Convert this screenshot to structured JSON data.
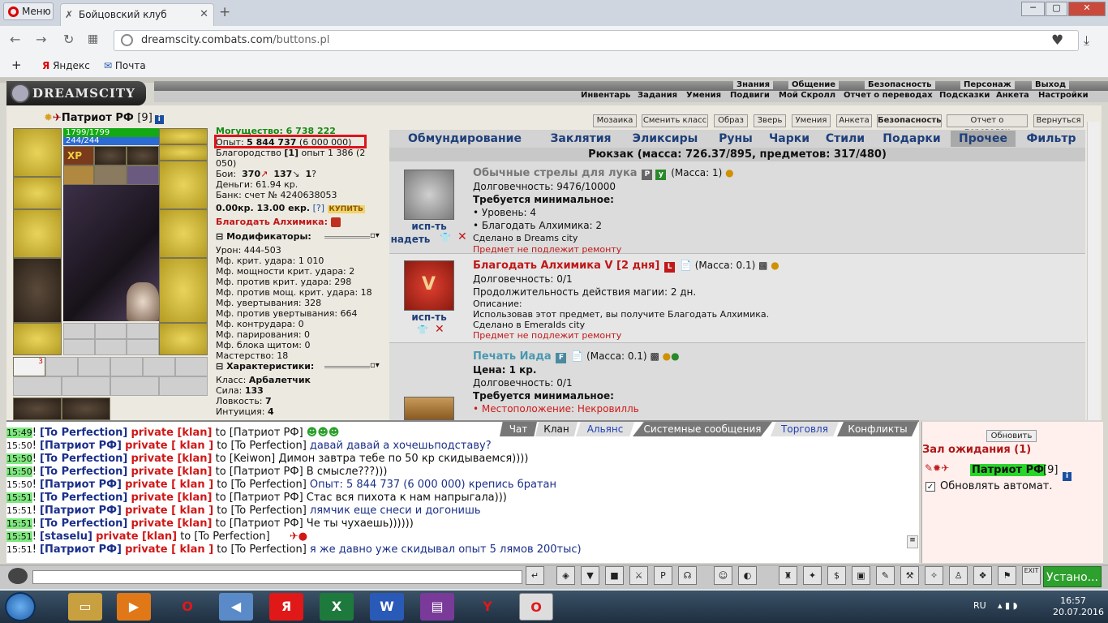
{
  "browser": {
    "menu_label": "Меню",
    "tab_title": "Бойцовский клуб",
    "url_host": "dreamscity.combats.com",
    "url_path": "/buttons.pl",
    "bookmarks": [
      "Яндекс",
      "Почта"
    ]
  },
  "game": {
    "logo": "DREAMSCITY",
    "top_menu": [
      "Знания",
      "Общение",
      "Безопасность",
      "Персонаж",
      "Выход"
    ],
    "sub_menu": [
      "Инвентарь",
      "Задания",
      "Умения",
      "Подвиги",
      "Мой Скролл",
      "Отчет о переводах",
      "Подсказки",
      "Анкета",
      "Настройки"
    ],
    "char": {
      "name": "Патриот РФ",
      "level": "[9]",
      "info_icon": "i",
      "hp": "1799/1799",
      "mp": "244/244",
      "belt_count": "3"
    },
    "stats": {
      "power": "Могущество: 6 738 222",
      "exp_label": "Опыт:",
      "exp_value": "5 844 737",
      "exp_next": "(6 000 000)",
      "nobility": "Благородство",
      "nobility_lvl": "[1]",
      "nobility_exp": "опыт 1 386 (2 050)",
      "fights": "Бои:",
      "wins": "370",
      "losses": "137",
      "draws": "1",
      "money": "Деньги: 61.94 кр.",
      "bank": "Банк: счет № 4240638053",
      "bank_kr": "0.00кр. 13.00 екр.",
      "help": "[?]",
      "buy": "КУПИТЬ",
      "blessing": "Благодать Алхимика:",
      "mods_header": "Модификаторы:",
      "mods": [
        "Урон: 444-503",
        "Мф. крит. удара: 1 010",
        "Мф. мощности крит. удара: 2",
        "Мф. против крит. удара: 298",
        "Мф. против мощ. крит. удара: 18",
        "Мф. увертывания: 328",
        "Мф. против увертывания: 664",
        "Мф. контрудара: 0",
        "Мф. парирования: 0",
        "Мф. блока щитом: 0",
        "Мастерство: 18"
      ],
      "chars_header": "Характеристики:",
      "chars": [
        "Класс:",
        "Арбалетчик",
        "Сила:",
        "133",
        "Ловкость:",
        "7",
        "Интуиция:",
        "4"
      ]
    },
    "buttons": [
      "Мозаика",
      "Сменить класс",
      "Образ",
      "Зверь",
      "Умения",
      "Анкета",
      "Безопасность",
      "Отчет о переводах",
      "Вернуться"
    ],
    "inv_tabs": [
      "Обмундирование",
      "Заклятия",
      "Эликсиры",
      "Руны",
      "Чарки",
      "Стили",
      "Подарки",
      "Прочее",
      "Фильтр"
    ],
    "rucksack": "Рюкзак (масса: 726.37/895, предметов: 317/480)",
    "items": [
      {
        "name": "Обычные стрелы для лука",
        "badges": [
          "P",
          "у"
        ],
        "mass": "(Масса: 1)",
        "durability": "Долговечность: 9476/10000",
        "req": "Требуется минимальное:",
        "req_items": [
          "• Уровень: 4",
          "• Благодать Алхимика: 2"
        ],
        "made": "Сделано в Dreams city",
        "norepair": "Предмет не подлежит ремонту",
        "act1": "исп-ть",
        "act2": "надеть"
      },
      {
        "name": "Благодать Алхимика V [2 дня]",
        "badge": "L",
        "mass": "(Масса: 0.1)",
        "durability": "Долговечность: 0/1",
        "duration": "Продолжительность действия магии: 2 дн.",
        "desc_label": "Описание:",
        "desc": "Использовав этот предмет, вы получите Благодать Алхимика.",
        "made": "Сделано в Emeralds city",
        "norepair": "Предмет не подлежит ремонту",
        "act1": "исп-ть"
      },
      {
        "name": "Печать Иада",
        "badge": "F",
        "mass": "(Масса: 0.1)",
        "price": "Цена: 1 кр.",
        "durability": "Долговечность: 0/1",
        "req": "Требуется минимальное:",
        "location": "• Местоположение: Некровилль"
      }
    ]
  },
  "chat": {
    "tabs": [
      "Чат",
      "Клан",
      "Альянс",
      "Системные сообщения",
      "Торговля",
      "Конфликты"
    ],
    "lines": [
      {
        "time": "15:49",
        "hl": true,
        "nick": "[To Perfection]",
        "priv": "private [klan]",
        "to": "to [Патриот РФ]",
        "text": ""
      },
      {
        "time": "15:50",
        "hl": false,
        "nick": "[Патриот РФ]",
        "priv": "private [ klan ]",
        "to": "to [To Perfection]",
        "text": "давай давай а хочешьподставу?"
      },
      {
        "time": "15:50",
        "hl": true,
        "nick": "[To Perfection]",
        "priv": "private [klan]",
        "to": "to [Keiwon]",
        "text": "Димон завтра тебе по 50 кр скидываемся))))"
      },
      {
        "time": "15:50",
        "hl": true,
        "nick": "[To Perfection]",
        "priv": "private [klan]",
        "to": "to [Патриот РФ]",
        "text": "В смысле???)))"
      },
      {
        "time": "15:50",
        "hl": false,
        "nick": "[Патриот РФ]",
        "priv": "private [ klan ]",
        "to": "to [To Perfection]",
        "text": "Опыт: 5 844 737 (6 000 000) крепись братан"
      },
      {
        "time": "15:51",
        "hl": true,
        "nick": "[To Perfection]",
        "priv": "private [klan]",
        "to": "to [Патриот РФ]",
        "text": "Стас вся пихота к нам напрыгала)))"
      },
      {
        "time": "15:51",
        "hl": false,
        "nick": "[Патриот РФ]",
        "priv": "private [ klan ]",
        "to": "to [To Perfection]",
        "text": "лямчик еще снеси и догонишь"
      },
      {
        "time": "15:51",
        "hl": true,
        "nick": "[To Perfection]",
        "priv": "private [klan]",
        "to": "to [Патриот РФ]",
        "text": "Че ты чухаешь))))))"
      },
      {
        "time": "15:51",
        "hl": true,
        "nick": "[staselu]",
        "priv": "private [klan]",
        "to": "to [To Perfection]",
        "text": ""
      },
      {
        "time": "15:51",
        "hl": false,
        "nick": "[Патриот РФ]",
        "priv": "private [ klan ]",
        "to": "to [To Perfection]",
        "text": "я же давно уже скидывал опыт 5 лямов 200тыс)"
      }
    ],
    "refresh": "Обновить",
    "waiting": "Зал ожидания (1)",
    "waiting_name": "Патриот РФ",
    "waiting_lvl": "[9]",
    "auto_update": "Обновлять автомат.",
    "set_button": "Устано..."
  },
  "taskbar": {
    "lang": "RU",
    "time": "16:57",
    "date": "20.07.2016"
  }
}
